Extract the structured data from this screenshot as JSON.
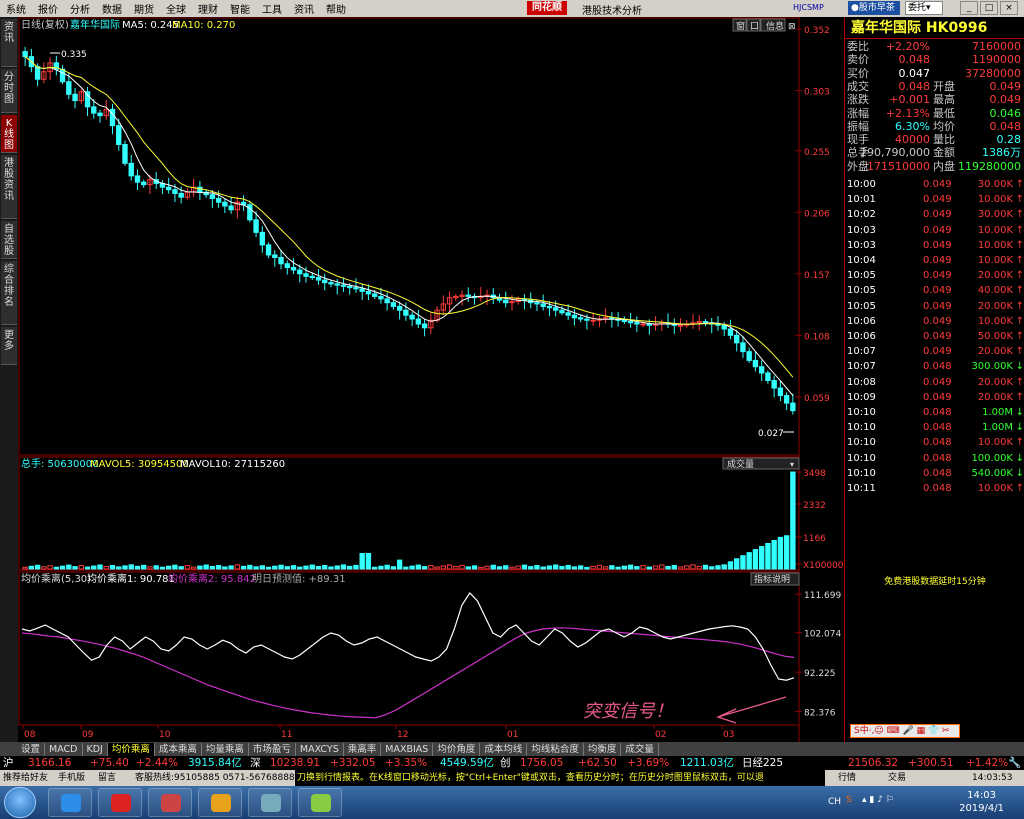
{
  "menu": [
    "系统",
    "报价",
    "分析",
    "数据",
    "期货",
    "全球",
    "理财",
    "智能",
    "工具",
    "资讯",
    "帮助"
  ],
  "brand": "同花顺",
  "app_name": "港股技术分析",
  "right_code": "HJCSMP",
  "morning_btn": "股市早茶",
  "delegate": "委托",
  "winbtns": [
    "_",
    "□",
    "×"
  ],
  "leftnav": [
    "资讯",
    "分时图",
    "K线图",
    "港股资讯",
    "自选股",
    "综合排名",
    "更多"
  ],
  "kline": {
    "header": "日线(复权)",
    "stock_name": "嘉年华国际",
    "ma5": "MA5: 0.245",
    "ma10": "MA10: 0.270",
    "panel_btns": [
      "窗",
      "口",
      "信息"
    ],
    "price_ticks": [
      "0.352",
      "0.303",
      "0.255",
      "0.206",
      "0.157",
      "0.108",
      "0.059"
    ],
    "high_label": "0.335",
    "low_label": "0.027"
  },
  "volume": {
    "total": "总手: 50630000",
    "mavol5": "MAVOL5: 30954500",
    "mavol10": "MAVOL10: 27115260",
    "selector": "成交量",
    "ticks": [
      "3498",
      "2332",
      "1166",
      "X100000"
    ]
  },
  "indicator": {
    "name": "均价乘离(5,30)",
    "line1": "均价乘离1: 90.781",
    "line2": "均价乘离2: 95.842",
    "forecast": "明日预测值: +89.31",
    "help_btn": "指标说明",
    "ticks": [
      "111.699",
      "102.074",
      "92.225",
      "82.376"
    ],
    "signal_text": "突变信号！"
  },
  "x_axis": [
    "08",
    "09",
    "10",
    "11",
    "12",
    "01",
    "02",
    "03"
  ],
  "chart_data": {
    "type": "candlestick",
    "ylim": [
      0.027,
      0.352
    ],
    "close": [
      0.33,
      0.322,
      0.312,
      0.318,
      0.325,
      0.32,
      0.31,
      0.3,
      0.295,
      0.302,
      0.29,
      0.285,
      0.283,
      0.288,
      0.275,
      0.26,
      0.245,
      0.235,
      0.23,
      0.228,
      0.232,
      0.229,
      0.226,
      0.224,
      0.221,
      0.218,
      0.222,
      0.226,
      0.222,
      0.22,
      0.217,
      0.214,
      0.211,
      0.208,
      0.214,
      0.212,
      0.2,
      0.19,
      0.18,
      0.172,
      0.17,
      0.165,
      0.162,
      0.16,
      0.157,
      0.155,
      0.154,
      0.152,
      0.15,
      0.149,
      0.148,
      0.147,
      0.146,
      0.145,
      0.143,
      0.141,
      0.139,
      0.137,
      0.134,
      0.131,
      0.128,
      0.124,
      0.121,
      0.117,
      0.114,
      0.12,
      0.128,
      0.133,
      0.138,
      0.139,
      0.14,
      0.139,
      0.138,
      0.139,
      0.14,
      0.138,
      0.136,
      0.134,
      0.135,
      0.137,
      0.136,
      0.134,
      0.133,
      0.131,
      0.13,
      0.128,
      0.126,
      0.124,
      0.122,
      0.121,
      0.12,
      0.12,
      0.121,
      0.122,
      0.121,
      0.12,
      0.119,
      0.118,
      0.117,
      0.117,
      0.116,
      0.117,
      0.118,
      0.117,
      0.116,
      0.116,
      0.117,
      0.118,
      0.119,
      0.118,
      0.117,
      0.116,
      0.113,
      0.108,
      0.102,
      0.095,
      0.088,
      0.083,
      0.078,
      0.072,
      0.066,
      0.06,
      0.054,
      0.048
    ],
    "volume_max": 3498,
    "volume_unit": "X100000",
    "indicator_ylim": [
      79,
      114
    ],
    "indicator_line1": [
      103,
      102.5,
      103.2,
      104,
      103,
      102,
      101,
      99,
      97,
      95.2,
      96,
      99,
      101,
      100,
      98,
      99.5,
      101,
      100,
      98,
      97.5,
      99,
      101,
      100.5,
      99,
      98,
      99,
      100.2,
      99.5,
      98,
      97,
      98.5,
      99,
      98,
      97,
      96,
      95.5,
      96.5,
      98,
      99.5,
      101,
      102,
      101.5,
      100,
      99,
      99.5,
      100.5,
      101,
      100,
      99,
      98,
      97,
      96,
      95.5,
      95,
      96,
      98,
      103,
      109,
      112,
      110,
      106,
      102,
      101,
      103,
      104,
      102,
      100,
      99,
      101,
      103,
      102,
      100,
      98.5,
      99.5,
      101,
      102.5,
      103,
      102,
      101,
      102,
      103.5,
      103,
      102,
      101,
      100.5,
      101,
      101.5,
      102,
      102.5,
      103,
      103.3,
      103.6,
      103.8,
      103.5,
      103,
      101,
      98,
      94,
      90.5,
      90.2,
      90.8
    ],
    "indicator_line2": [
      102,
      101.8,
      101.5,
      101.2,
      101,
      100.6,
      100.2,
      99.8,
      99.3,
      98.8,
      98.2,
      97.5,
      96.8,
      96,
      95,
      94,
      93,
      92,
      91,
      90,
      89,
      88.2,
      87.4,
      86.6,
      85.8,
      85.1,
      84.5,
      83.9,
      83.4,
      82.9,
      82.5,
      82.1,
      81.8,
      81.5,
      81.3,
      81.1,
      81,
      80.9,
      80.8,
      81.5,
      82.5,
      83.8,
      85.2,
      86.6,
      88,
      89.4,
      90.8,
      92.2,
      93.6,
      95,
      96.4,
      97.8,
      99.2,
      100.6,
      101.8,
      102.5,
      103,
      103.2,
      103.3,
      103.2,
      103,
      102.8,
      102.6,
      102.4,
      102.2,
      102,
      101.8,
      101.6,
      101.4,
      101.2,
      101,
      100.8,
      100.6,
      100.4,
      100.2,
      100,
      99.7,
      99.3,
      98.8,
      98.2,
      97.5,
      96.8,
      96.2,
      95.9
    ]
  },
  "quote": {
    "title": "嘉年华国际 HK0996",
    "rows": [
      {
        "l1": "委比",
        "v1": "+2.20%",
        "l2": "",
        "v2": "7160000",
        "c1": "#ff3b3b",
        "c2": "#ff3b3b"
      },
      {
        "l1": "卖价",
        "v1": "0.048",
        "l2": "",
        "v2": "1190000",
        "c1": "#ff3b3b",
        "c2": "#ff3b3b"
      },
      {
        "l1": "买价",
        "v1": "0.047",
        "l2": "",
        "v2": "37280000",
        "c1": "#ffffff",
        "c2": "#ff3b3b"
      },
      {
        "l1": "成交",
        "v1": "0.048",
        "l2": "开盘",
        "v2": "0.049",
        "c1": "#ff3b3b",
        "c2": "#ff3b3b"
      },
      {
        "l1": "涨跌",
        "v1": "+0.001",
        "l2": "最高",
        "v2": "0.049",
        "c1": "#ff3b3b",
        "c2": "#ff3b3b"
      },
      {
        "l1": "涨幅",
        "v1": "+2.13%",
        "l2": "最低",
        "v2": "0.046",
        "c1": "#ff3b3b",
        "c2": "#33ff33"
      },
      {
        "l1": "振幅",
        "v1": "6.30%",
        "l2": "均价",
        "v2": "0.048",
        "c1": "#33ffff",
        "c2": "#ff3b3b"
      },
      {
        "l1": "现手",
        "v1": "40000",
        "l2": "量比",
        "v2": "0.28",
        "c1": "#ff3b3b",
        "c2": "#33ffff"
      },
      {
        "l1": "总手",
        "v1": "290,790,000",
        "l2": "金额",
        "v2": "1386万",
        "c1": "#c8c8c8",
        "c2": "#33ffff"
      },
      {
        "l1": "外盘",
        "v1": "171510000",
        "l2": "内盘",
        "v2": "119280000",
        "c1": "#ff3b3b",
        "c2": "#33ff33"
      }
    ],
    "ticks": [
      {
        "t": "10:00",
        "p": "0.049",
        "v": "30.00K",
        "d": "down"
      },
      {
        "t": "10:01",
        "p": "0.049",
        "v": "10.00K",
        "d": "down"
      },
      {
        "t": "10:02",
        "p": "0.049",
        "v": "30.00K",
        "d": "down"
      },
      {
        "t": "10:03",
        "p": "0.049",
        "v": "10.00K",
        "d": "down"
      },
      {
        "t": "10:03",
        "p": "0.049",
        "v": "10.00K",
        "d": "down"
      },
      {
        "t": "10:04",
        "p": "0.049",
        "v": "10.00K",
        "d": "down"
      },
      {
        "t": "10:05",
        "p": "0.049",
        "v": "20.00K",
        "d": "down"
      },
      {
        "t": "10:05",
        "p": "0.049",
        "v": "40.00K",
        "d": "down"
      },
      {
        "t": "10:05",
        "p": "0.049",
        "v": "20.00K",
        "d": "down"
      },
      {
        "t": "10:06",
        "p": "0.049",
        "v": "10.00K",
        "d": "down"
      },
      {
        "t": "10:06",
        "p": "0.049",
        "v": "50.00K",
        "d": "down"
      },
      {
        "t": "10:07",
        "p": "0.049",
        "v": "20.00K",
        "d": "down"
      },
      {
        "t": "10:07",
        "p": "0.048",
        "v": "300.00K",
        "d": "up"
      },
      {
        "t": "10:08",
        "p": "0.049",
        "v": "20.00K",
        "d": "down"
      },
      {
        "t": "10:09",
        "p": "0.049",
        "v": "20.00K",
        "d": "down"
      },
      {
        "t": "10:10",
        "p": "0.048",
        "v": "1.00M",
        "d": "up"
      },
      {
        "t": "10:10",
        "p": "0.048",
        "v": "1.00M",
        "d": "up"
      },
      {
        "t": "10:10",
        "p": "0.048",
        "v": "10.00K",
        "d": "down"
      },
      {
        "t": "10:10",
        "p": "0.048",
        "v": "100.00K",
        "d": "up"
      },
      {
        "t": "10:10",
        "p": "0.048",
        "v": "540.00K",
        "d": "up"
      },
      {
        "t": "10:11",
        "p": "0.048",
        "v": "10.00K",
        "d": "down"
      }
    ],
    "free_info": "免费港股数据延时15分钟"
  },
  "ime_text": "S中·,☺ ⌨ 🎤 ▦ 👕 ✂",
  "tabs": [
    "设置",
    "MACD",
    "KDJ",
    "均价乘离",
    "成本乘离",
    "均量乘离",
    "市场盈亏",
    "MAXCYS",
    "乘离率",
    "MAXBIAS",
    "均价角度",
    "成本均线",
    "均线粘合度",
    "均衡度",
    "成交量"
  ],
  "active_tab": "均价乘离",
  "index_bar": [
    {
      "t": "沪",
      "c": "#ffffff",
      "x": 3
    },
    {
      "t": "3166.16",
      "c": "#ff3b3b",
      "x": 28
    },
    {
      "t": "+75.40",
      "c": "#ff3b3b",
      "x": 90
    },
    {
      "t": "+2.44%",
      "c": "#ff3b3b",
      "x": 136
    },
    {
      "t": "3915.84亿",
      "c": "#33ffff",
      "x": 188
    },
    {
      "t": "深",
      "c": "#ffffff",
      "x": 250
    },
    {
      "t": "10238.91",
      "c": "#ff3b3b",
      "x": 270
    },
    {
      "t": "+332.05",
      "c": "#ff3b3b",
      "x": 330
    },
    {
      "t": "+3.35%",
      "c": "#ff3b3b",
      "x": 385
    },
    {
      "t": "4549.59亿",
      "c": "#33ffff",
      "x": 440
    },
    {
      "t": "创",
      "c": "#ffffff",
      "x": 500
    },
    {
      "t": "1756.05",
      "c": "#ff3b3b",
      "x": 520
    },
    {
      "t": "+62.50",
      "c": "#ff3b3b",
      "x": 578
    },
    {
      "t": "+3.69%",
      "c": "#ff3b3b",
      "x": 627
    },
    {
      "t": "1211.03亿",
      "c": "#33ffff",
      "x": 680
    },
    {
      "t": "日经225",
      "c": "#ffffff",
      "x": 742
    },
    {
      "t": "21506.32",
      "c": "#ff3b3b",
      "x": 848
    },
    {
      "t": "+300.51",
      "c": "#ff3b3b",
      "x": 908
    },
    {
      "t": "+1.42%",
      "c": "#ff3b3b",
      "x": 966
    }
  ],
  "status": {
    "items": [
      "推荐给好友",
      "手机版",
      "留言",
      "客服热线:95105885 0571-56768888"
    ],
    "ticker": "刀换到行情报表。在K线窗口移动光标，按\"Ctrl+Enter\"键或双击，查看历史分时；在历史分时图里鼠标双击，可以退",
    "right_items": [
      "行情",
      "交易"
    ],
    "time": "14:03:53"
  },
  "taskbar": {
    "tray_lang": "CH",
    "clock_time": "14:03",
    "clock_date": "2019/4/1"
  }
}
